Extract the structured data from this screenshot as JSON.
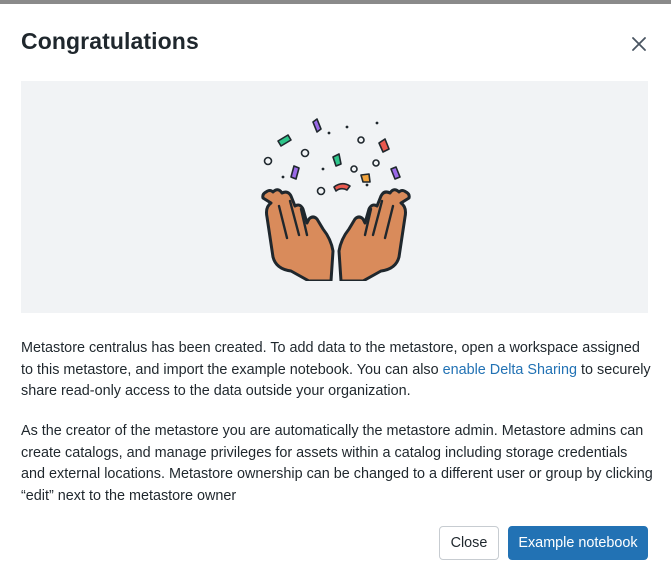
{
  "dialog": {
    "title": "Congratulations",
    "close_icon": "close-icon",
    "illustration": "confetti-hands-illustration",
    "paragraph1": {
      "before_link": "Metastore centralus has been created. To add data to the metastore, open a workspace assigned to this metastore, and import the example notebook. You can also ",
      "link": "enable Delta Sharing",
      "after_link": " to securely share read-only access to the data outside your organization."
    },
    "paragraph2": "As the creator of the metastore you are automatically the metastore admin. Metastore admins can create catalogs, and manage privileges for assets within a catalog including storage credentials and external locations. Metastore ownership can be changed to a different user or group by clicking “edit” next to the metastore owner",
    "buttons": {
      "close": "Close",
      "primary": "Example notebook"
    }
  },
  "colors": {
    "primary": "#2272b4",
    "link": "#2272b4",
    "illustration_bg": "#f1f3f5",
    "text": "#1f272d"
  }
}
